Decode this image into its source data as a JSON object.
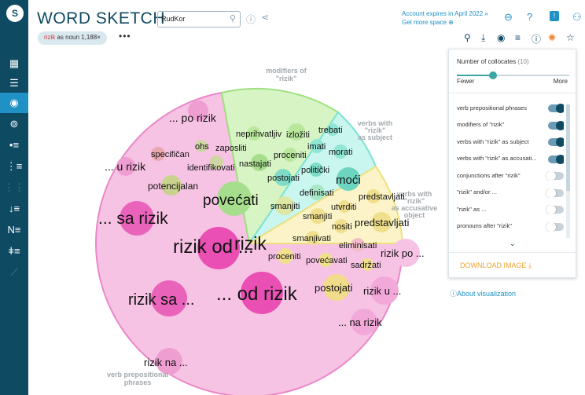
{
  "header": {
    "app_title": "WORD SKETCH",
    "corpus_value": "RudKor",
    "account_line1": "Account expires in April 2022 »",
    "account_line2": "Get more space ⊕"
  },
  "query": {
    "lemma": "rizik",
    "pos_and_freq": "as noun 1,188×",
    "menu": "•••"
  },
  "sidebar_icons": [
    "home-icon",
    "list-icon",
    "wordsketch-icon",
    "thesaurus-icon",
    "concordance-icon",
    "parallel-icon",
    "diff-icon",
    "wordlist-icon",
    "ngram-icon",
    "keywords-icon",
    "trends-icon"
  ],
  "colors": {
    "sidebar": "#0f4a63",
    "accent": "#1f91c4",
    "pink": "#f3a9d6",
    "green": "#b8ec9f",
    "cyan": "#b2f1e8",
    "yellow": "#fbf0b0",
    "download": "#f0a22e"
  },
  "visualization": {
    "sectors": [
      "modifiers of \"rizik\"",
      "verbs with \"rizik\" as subject",
      "verbs with \"rizik\" as accusative object",
      "verb prepositional phrases"
    ],
    "sector_labels": [
      [
        "modifiers of",
        "\"rizik\""
      ],
      [
        "verbs with",
        "\"rizik\"",
        "as subject"
      ],
      [
        "verbs with",
        "\"rizik\"",
        "as accusative",
        "object"
      ],
      [
        "verb prepositional",
        "phrases"
      ]
    ],
    "center_word": "rizik",
    "words": [
      "... po rizik",
      "specifičan",
      "ohs",
      "zaposliti",
      "identifikovati",
      "... u rizik",
      "potencijalan",
      "... sa rizik",
      "rizik od ...",
      "rizik sa ...",
      "... od rizik",
      "rizik na ...",
      "neprihvatljiv",
      "izložiti",
      "nastajati",
      "proceniti",
      "povećati",
      "trebati",
      "imati",
      "morati",
      "politički",
      "postojati",
      "moći",
      "definisati",
      "smanjiti",
      "predstavljati",
      "utvrditi",
      "smanjiti",
      "nositi",
      "predstavljati",
      "smanjivati",
      "eliminisati",
      "proceniti",
      "povećavati",
      "sadržati",
      "postojati",
      "rizik po ...",
      "rizik u ...",
      "... na rizik"
    ]
  },
  "settings_panel": {
    "collocates_label": "Number of collocates",
    "collocates_count": "(10)",
    "collocates_slider_fraction": 0.32,
    "fewer_label": "Fewer",
    "more_label": "More",
    "toggles": [
      {
        "label": "verb prepositional phrases",
        "on": true
      },
      {
        "label": "modifiers of \"rizik\"",
        "on": true
      },
      {
        "label": "verbs with \"rizik\" as subject",
        "on": true
      },
      {
        "label": "verbs with \"rizik\" as accusati...",
        "on": true
      },
      {
        "label": "conjunctions after \"rizik\"",
        "on": false
      },
      {
        "label": "\"rizik\" and/or ...",
        "on": false
      },
      {
        "label": "\"rizik\" as ...",
        "on": false
      },
      {
        "label": "pronouns after \"rizik\"",
        "on": false
      }
    ],
    "download_label": "DOWNLOAD IMAGE"
  },
  "about_link": "ⓘAbout visualization"
}
